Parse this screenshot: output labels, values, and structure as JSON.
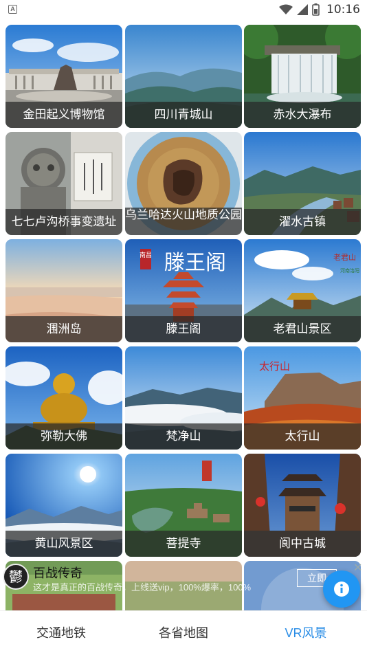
{
  "status_bar": {
    "notification_icon": "A",
    "time": "10:16",
    "icons": [
      "wifi-icon",
      "signal-icon",
      "battery-icon"
    ]
  },
  "scenic_spots": [
    {
      "name": "金田起义博物馆",
      "image": "museum"
    },
    {
      "name": "四川青城山",
      "image": "mountain-mist"
    },
    {
      "name": "赤水大瀑布",
      "image": "waterfall"
    },
    {
      "name": "七七卢沟桥事变遗址",
      "image": "stone-lion"
    },
    {
      "name": "乌兰哈达火山地质公园",
      "image": "volcano-planet"
    },
    {
      "name": "濯水古镇",
      "image": "river-town"
    },
    {
      "name": "涠洲岛",
      "image": "beach-sunset"
    },
    {
      "name": "滕王阁",
      "image": "pavilion"
    },
    {
      "name": "老君山景区",
      "image": "temple-peak"
    },
    {
      "name": "弥勒大佛",
      "image": "golden-buddha"
    },
    {
      "name": "梵净山",
      "image": "sea-of-clouds"
    },
    {
      "name": "太行山",
      "image": "autumn-cliffs"
    },
    {
      "name": "黄山风景区",
      "image": "sun-over-peaks"
    },
    {
      "name": "菩提寺",
      "image": "temple-aerial"
    },
    {
      "name": "阆中古城",
      "image": "ancient-tower"
    }
  ],
  "overlay_text": {
    "tengwang_poster_title": "滕王阁",
    "tengwang_poster_tag": "南昌",
    "laojun_poster_title": "老君山",
    "laojun_poster_tag": "河南洛阳",
    "taihang_poster_title": "太行山"
  },
  "ad_banner": {
    "logo_char": "鬱",
    "title": "百战传奇",
    "description": "这才是真正的百战传奇，上线送vip，100%爆率，100%",
    "cta_label": "立即",
    "close_label": "✕"
  },
  "bottom_tabs": [
    {
      "label": "交通地铁",
      "active": false
    },
    {
      "label": "各省地图",
      "active": false
    },
    {
      "label": "VR风景",
      "active": true
    }
  ],
  "colors": {
    "accent": "#2a8de6",
    "fab": "#2196f3",
    "label_overlay": "#282828"
  }
}
